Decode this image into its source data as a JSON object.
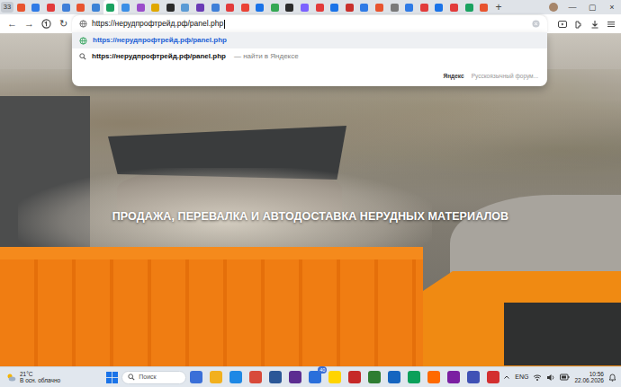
{
  "browser": {
    "tab_count": "33",
    "tabs": [
      {
        "color": "#e8542f",
        "selected": false
      },
      {
        "color": "#2f7be6",
        "selected": false
      },
      {
        "color": "#e23b3b",
        "selected": false
      },
      {
        "color": "#3e7fd8",
        "selected": false
      },
      {
        "color": "#e8542f",
        "selected": false
      },
      {
        "color": "#3b82d6",
        "selected": false
      },
      {
        "color": "#1aa260",
        "selected": true
      },
      {
        "color": "#3a8ee6",
        "selected": false
      },
      {
        "color": "#9b4dca",
        "selected": false
      },
      {
        "color": "#e0a800",
        "selected": false
      },
      {
        "color": "#2b2b2b",
        "selected": false
      },
      {
        "color": "#5b9bd5",
        "selected": false
      },
      {
        "color": "#6a3bb5",
        "selected": false
      },
      {
        "color": "#3e7fd8",
        "selected": false
      },
      {
        "color": "#e23b3b",
        "selected": false
      },
      {
        "color": "#ea4335",
        "selected": false
      },
      {
        "color": "#1a73e8",
        "selected": false
      },
      {
        "color": "#34a853",
        "selected": false
      },
      {
        "color": "#2b2b2b",
        "selected": false
      },
      {
        "color": "#7b61ff",
        "selected": false
      },
      {
        "color": "#e23b3b",
        "selected": false
      },
      {
        "color": "#1a73e8",
        "selected": false
      },
      {
        "color": "#c9302c",
        "selected": false
      },
      {
        "color": "#2f7be6",
        "selected": false
      },
      {
        "color": "#e8542f",
        "selected": false
      },
      {
        "color": "#7a7a7a",
        "selected": false
      },
      {
        "color": "#2f7be6",
        "selected": false
      },
      {
        "color": "#e23b3b",
        "selected": false
      },
      {
        "color": "#1a73e8",
        "selected": false
      },
      {
        "color": "#e23b3b",
        "selected": false
      },
      {
        "color": "#1aa260",
        "selected": false
      },
      {
        "color": "#e8542f",
        "selected": false
      }
    ],
    "new_tab": "+",
    "window_controls": [
      "—",
      "▢",
      "×"
    ],
    "nav_buttons": [
      "←",
      "→",
      "↻"
    ]
  },
  "address_bar": {
    "value": "https://нерудпрофтрейд.рф/panel.php"
  },
  "suggestions": [
    {
      "text": "https://нерудпрофтрейд.рф/panel.php",
      "suffix": "",
      "kind": "url",
      "selected": true
    },
    {
      "text": "https://нерудпрофтрейд.рф/panel.php",
      "suffix": "— найти в Яндексе",
      "kind": "search",
      "selected": false
    }
  ],
  "search_engines": [
    "Яндекс",
    "Русскоязычный форум..."
  ],
  "page": {
    "headline": "ПРОДАЖА, ПЕРЕВАЛКА И АВТОДОСТАВКА НЕРУДНЫХ МАТЕРИАЛОВ"
  },
  "taskbar": {
    "weather": {
      "temp": "21°C",
      "desc": "В осн. облачно"
    },
    "search": "Поиск",
    "apps": [
      {
        "color": "#3a6fd8"
      },
      {
        "color": "#f2b01e"
      },
      {
        "color": "#1e88e5"
      },
      {
        "color": "#d84a3a"
      },
      {
        "color": "#2b5797"
      },
      {
        "color": "#5c2d91"
      },
      {
        "color": "#2a6fdb",
        "badge": "40"
      },
      {
        "color": "#ffd400"
      },
      {
        "color": "#c62828"
      },
      {
        "color": "#2e7d32"
      },
      {
        "color": "#1565c0"
      },
      {
        "color": "#0aa05a"
      },
      {
        "color": "#ff6a00"
      },
      {
        "color": "#7b1fa2"
      },
      {
        "color": "#3f51b5"
      },
      {
        "color": "#d32f2f"
      }
    ],
    "lang": "ENG",
    "time": "10:56",
    "date": "22.06.2026"
  }
}
